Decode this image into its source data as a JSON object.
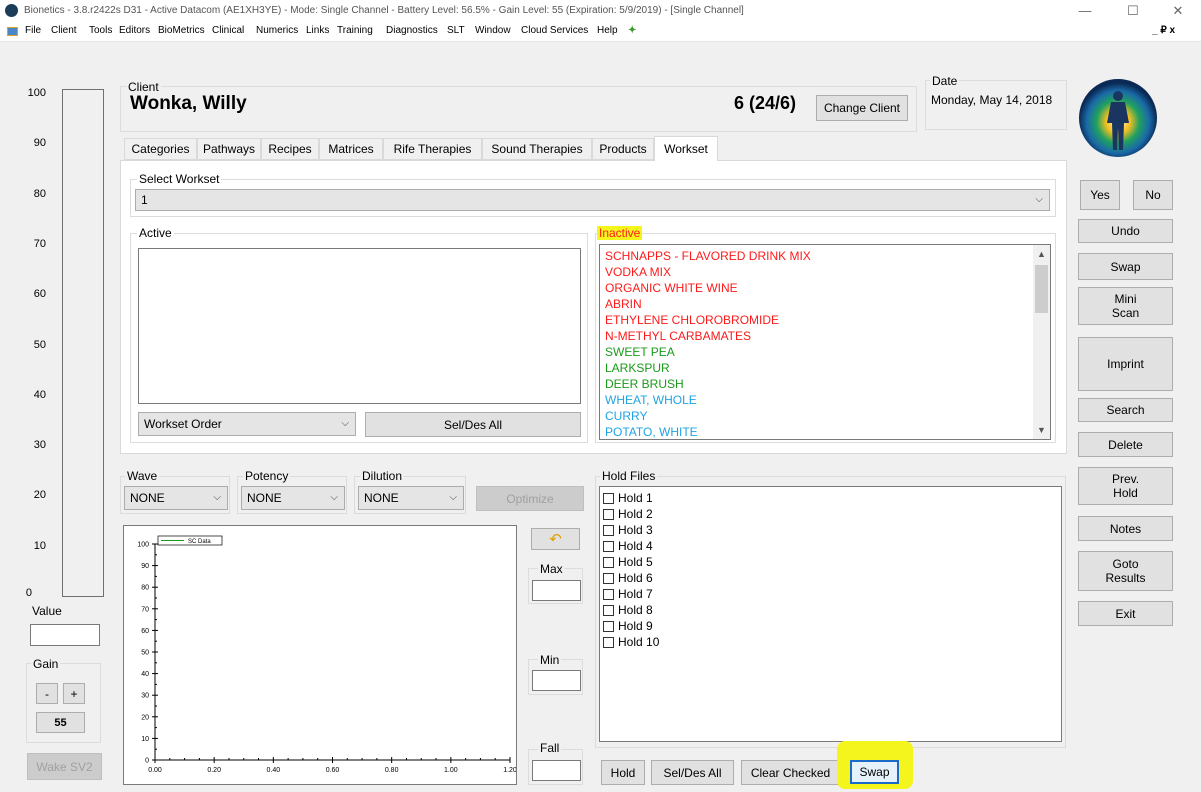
{
  "titlebar": {
    "title": "Bionetics - 3.8.r2422s D31 - Active Datacom (AE1XH3YE) - Mode: Single Channel - Battery Level: 56.5% - Gain Level: 55 (Expiration: 5/9/2019) - [Single Channel]",
    "minimize": "—",
    "maximize": "☐",
    "close": "✕",
    "mdi_controls": "_ ₽ x"
  },
  "menu": [
    "File",
    "Client",
    "Tools",
    "Editors",
    "BioMetrics",
    "Clinical",
    "Numerics",
    "Links",
    "Training",
    "Diagnostics",
    "SLT",
    "Window",
    "Cloud Services",
    "Help"
  ],
  "gauge": {
    "scale": [
      "100",
      "90",
      "80",
      "70",
      "60",
      "50",
      "40",
      "30",
      "20",
      "10",
      "0"
    ]
  },
  "value_label": "Value",
  "gain": {
    "label": "Gain",
    "minus": "-",
    "plus": "+",
    "value": "55"
  },
  "wake_button": "Wake SV2",
  "client": {
    "label": "Client",
    "name": "Wonka, Willy",
    "count": "6 (24/6)",
    "change": "Change Client"
  },
  "date": {
    "label": "Date",
    "value": "Monday, May 14, 2018"
  },
  "tabs": [
    "Categories",
    "Pathways",
    "Recipes",
    "Matrices",
    "Rife Therapies",
    "Sound Therapies",
    "Products",
    "Workset"
  ],
  "workset": {
    "label": "Select Workset",
    "selected": "1"
  },
  "active": {
    "label": "Active",
    "order": "Workset Order",
    "seldes": "Sel/Des All"
  },
  "inactive": {
    "label": "Inactive",
    "items": [
      {
        "text": "SCHNAPPS - FLAVORED DRINK MIX",
        "color": "#ff1a1a"
      },
      {
        "text": "VODKA MIX",
        "color": "#ff1a1a"
      },
      {
        "text": "ORGANIC WHITE WINE",
        "color": "#ff1a1a"
      },
      {
        "text": "ABRIN",
        "color": "#ff1a1a"
      },
      {
        "text": "ETHYLENE CHLOROBROMIDE",
        "color": "#ff1a1a"
      },
      {
        "text": "N-METHYL CARBAMATES",
        "color": "#ff1a1a"
      },
      {
        "text": "SWEET PEA",
        "color": "#1a9a1a"
      },
      {
        "text": "LARKSPUR",
        "color": "#1a9a1a"
      },
      {
        "text": "DEER BRUSH",
        "color": "#1a9a1a"
      },
      {
        "text": "WHEAT, WHOLE",
        "color": "#1fa3e0"
      },
      {
        "text": "CURRY",
        "color": "#1fa3e0"
      },
      {
        "text": "POTATO, WHITE",
        "color": "#1fa3e0"
      }
    ]
  },
  "wave": {
    "label": "Wave",
    "value": "NONE"
  },
  "potency": {
    "label": "Potency",
    "value": "NONE"
  },
  "dilution": {
    "label": "Dilution",
    "value": "NONE"
  },
  "optimize": "Optimize",
  "chart_data": {
    "type": "line",
    "series": [
      {
        "name": "SC Data",
        "values": []
      }
    ],
    "yticks": [
      "100",
      "90",
      "80",
      "70",
      "60",
      "50",
      "40",
      "30",
      "20",
      "10",
      "0"
    ],
    "xticks": [
      "0.00",
      "0.20",
      "0.40",
      "0.60",
      "0.80",
      "1.00",
      "1.20"
    ],
    "xlim": [
      0,
      1.2
    ],
    "ylim": [
      0,
      100
    ],
    "grid": false,
    "legend": "top-left"
  },
  "side_fields": {
    "max": "Max",
    "min": "Min",
    "fall": "Fall"
  },
  "hold": {
    "label": "Hold Files",
    "items": [
      "Hold 1",
      "Hold 2",
      "Hold 3",
      "Hold 4",
      "Hold 5",
      "Hold 6",
      "Hold 7",
      "Hold 8",
      "Hold 9",
      "Hold 10"
    ],
    "buttons": {
      "hold": "Hold",
      "seldes": "Sel/Des All",
      "clear": "Clear Checked",
      "swap": "Swap"
    }
  },
  "right": {
    "yes": "Yes",
    "no": "No",
    "undo": "Undo",
    "swap": "Swap",
    "mini": "Mini\nScan",
    "imprint": "Imprint",
    "search": "Search",
    "delete": "Delete",
    "prev": "Prev.\nHold",
    "notes": "Notes",
    "goto": "Goto\nResults",
    "exit": "Exit"
  }
}
